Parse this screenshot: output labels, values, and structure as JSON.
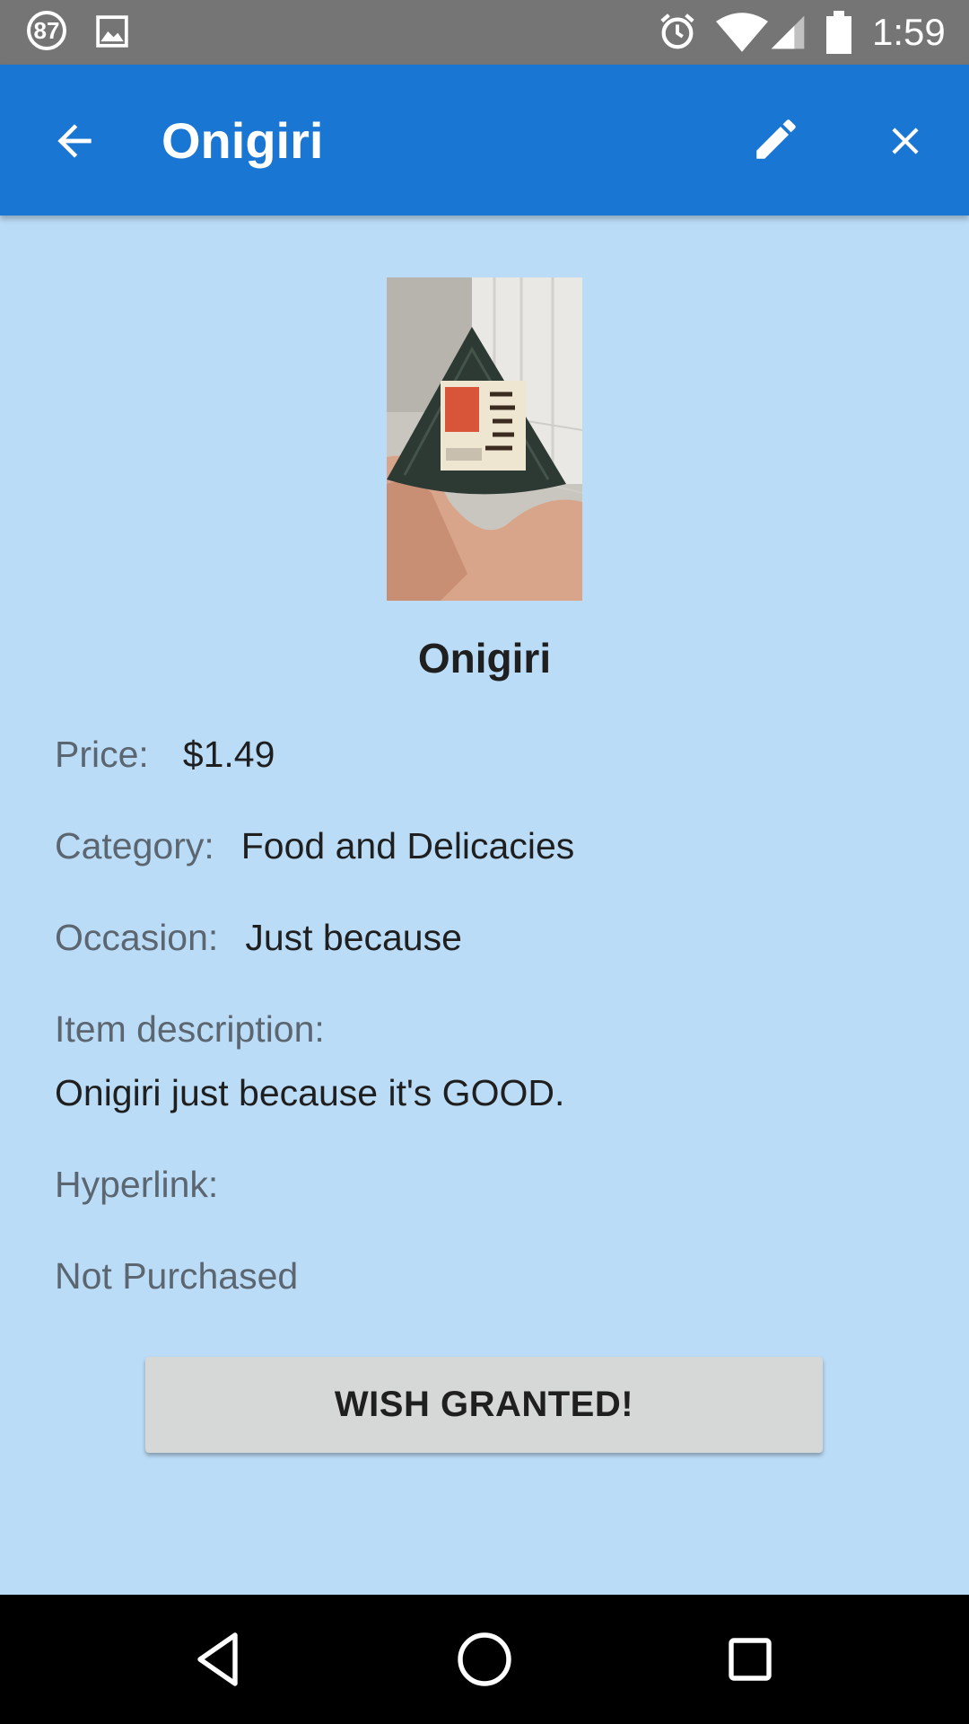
{
  "status_bar": {
    "notification_count": "87",
    "time": "1:59",
    "icons": [
      "gallery-icon",
      "alarm-icon",
      "wifi-icon",
      "signal-icon",
      "battery-icon"
    ]
  },
  "app_bar": {
    "title": "Onigiri",
    "icons": [
      "back-arrow-icon",
      "pencil-icon",
      "close-icon"
    ],
    "color": "#1976d2"
  },
  "item": {
    "name": "Onigiri",
    "price_label": "Price:",
    "price": "$1.49",
    "category_label": "Category:",
    "category": "Food and Delicacies",
    "occasion_label": "Occasion:",
    "occasion": "Just because",
    "description_label": "Item description:",
    "description": "Onigiri just because it's GOOD.",
    "hyperlink_label": "Hyperlink:",
    "status": "Not Purchased"
  },
  "actions": {
    "wish_granted_label": "WISH GRANTED!"
  },
  "nav_bar": {
    "icons": [
      "nav-back-icon",
      "nav-home-icon",
      "nav-recents-icon"
    ]
  },
  "colors": {
    "background": "#bbdcf7",
    "status_bar": "#757575",
    "button": "#d6d7d7"
  }
}
